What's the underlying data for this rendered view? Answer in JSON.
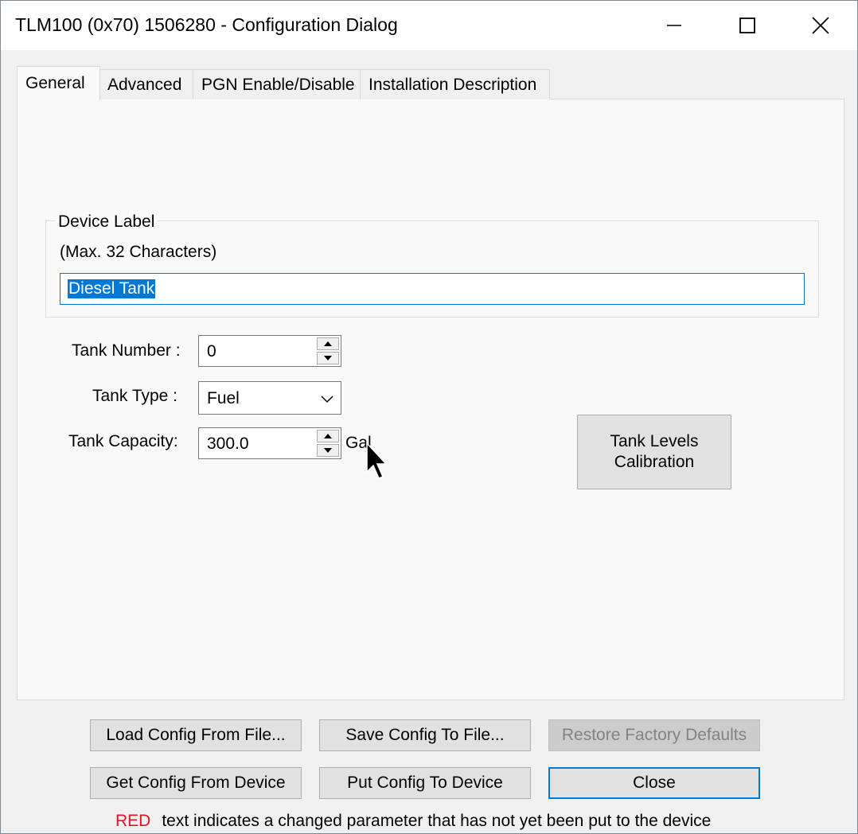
{
  "window": {
    "title": "TLM100 (0x70) 1506280 - Configuration Dialog",
    "controls": [
      "minimize-icon",
      "maximize-icon",
      "close-icon"
    ]
  },
  "tabs": [
    {
      "label": "General",
      "active": true
    },
    {
      "label": "Advanced",
      "active": false
    },
    {
      "label": "PGN Enable/Disable",
      "active": false
    },
    {
      "label": "Installation Description",
      "active": false
    }
  ],
  "device_label": {
    "legend": "Device Label",
    "hint": "(Max. 32 Characters)",
    "value": "Diesel Tank"
  },
  "fields": {
    "tank_number": {
      "label": "Tank Number :",
      "value": "0"
    },
    "tank_type": {
      "label": "Tank Type :",
      "value": "Fuel"
    },
    "tank_capacity": {
      "label": "Tank Capacity:",
      "value": "300.0",
      "unit": "Gal"
    }
  },
  "calibration_button": {
    "line1": "Tank Levels",
    "line2": "Calibration"
  },
  "buttons": {
    "load_config": "Load Config From File...",
    "save_config": "Save Config To File...",
    "restore_defaults": "Restore Factory Defaults",
    "get_config": "Get Config From Device",
    "put_config": "Put Config To Device",
    "close": "Close"
  },
  "footer": {
    "red_word": "RED",
    "text": "text indicates a changed parameter that has not yet been put to the device"
  },
  "colors": {
    "accent": "#0078d7",
    "warning_red": "#e81123"
  }
}
